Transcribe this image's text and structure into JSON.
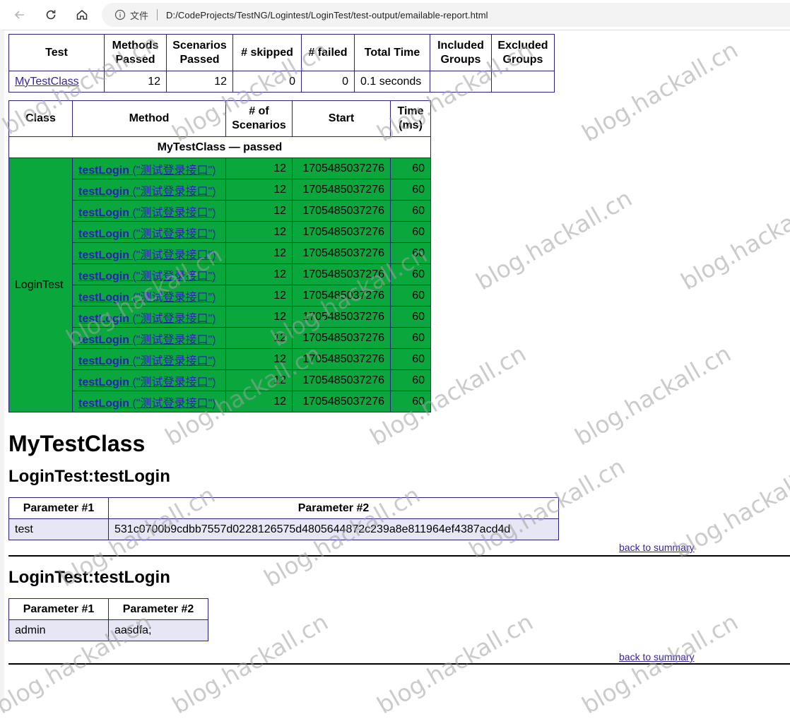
{
  "browser": {
    "file_label": "文件",
    "url": "D:/CodeProjects/TestNG/Logintest/LoginTest/test-output/emailable-report.html"
  },
  "summary": {
    "headers": [
      "Test",
      "Methods Passed",
      "Scenarios Passed",
      "# skipped",
      "# failed",
      "Total Time",
      "Included Groups",
      "Excluded Groups"
    ],
    "row": {
      "test": "MyTestClass",
      "methods_passed": "12",
      "scenarios_passed": "12",
      "skipped": "0",
      "failed": "0",
      "total_time": "0.1 seconds",
      "included_groups": "",
      "excluded_groups": ""
    }
  },
  "methods_table": {
    "headers": [
      "Class",
      "Method",
      "# of Scenarios",
      "Start",
      "Time (ms)"
    ],
    "group_label": "MyTestClass — passed",
    "class_name": "LoginTest",
    "rows": [
      {
        "method": "testLogin",
        "desc": "(\"测试登录接口\")",
        "scenarios": "12",
        "start": "1705485037276",
        "time": "60"
      },
      {
        "method": "testLogin",
        "desc": "(\"测试登录接口\")",
        "scenarios": "12",
        "start": "1705485037276",
        "time": "60"
      },
      {
        "method": "testLogin",
        "desc": "(\"测试登录接口\")",
        "scenarios": "12",
        "start": "1705485037276",
        "time": "60"
      },
      {
        "method": "testLogin",
        "desc": "(\"测试登录接口\")",
        "scenarios": "12",
        "start": "1705485037276",
        "time": "60"
      },
      {
        "method": "testLogin",
        "desc": "(\"测试登录接口\")",
        "scenarios": "12",
        "start": "1705485037276",
        "time": "60"
      },
      {
        "method": "testLogin",
        "desc": "(\"测试登录接口\")",
        "scenarios": "12",
        "start": "1705485037276",
        "time": "60"
      },
      {
        "method": "testLogin",
        "desc": "(\"测试登录接口\")",
        "scenarios": "12",
        "start": "1705485037276",
        "time": "60"
      },
      {
        "method": "testLogin",
        "desc": "(\"测试登录接口\")",
        "scenarios": "12",
        "start": "1705485037276",
        "time": "60"
      },
      {
        "method": "testLogin",
        "desc": "(\"测试登录接口\")",
        "scenarios": "12",
        "start": "1705485037276",
        "time": "60"
      },
      {
        "method": "testLogin",
        "desc": "(\"测试登录接口\")",
        "scenarios": "12",
        "start": "1705485037276",
        "time": "60"
      },
      {
        "method": "testLogin",
        "desc": "(\"测试登录接口\")",
        "scenarios": "12",
        "start": "1705485037276",
        "time": "60"
      },
      {
        "method": "testLogin",
        "desc": "(\"测试登录接口\")",
        "scenarios": "12",
        "start": "1705485037276",
        "time": "60"
      }
    ]
  },
  "class_title": "MyTestClass",
  "details": [
    {
      "title": "LoginTest:testLogin",
      "headers": [
        "Parameter #1",
        "Parameter #2"
      ],
      "values": [
        "test",
        "531c0700b9cdbb7557d0228126575d4805644872c239a8e811964ef4387acd4d"
      ],
      "back_link": "back to summary"
    },
    {
      "title": "LoginTest:testLogin",
      "headers": [
        "Parameter #1",
        "Parameter #2"
      ],
      "values": [
        "admin",
        "aasdfa;"
      ],
      "back_link": "back to summary"
    }
  ],
  "watermark": "blog.hackall.cn"
}
